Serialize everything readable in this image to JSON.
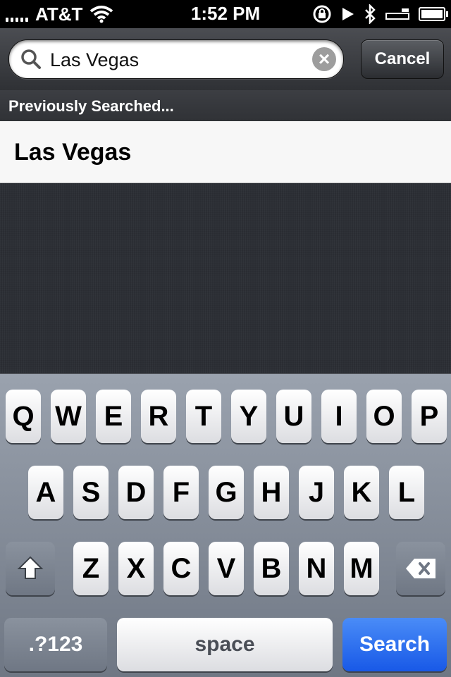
{
  "status_bar": {
    "carrier": "AT&T",
    "time": "1:52 PM"
  },
  "search": {
    "value": "Las Vegas",
    "cancel_label": "Cancel"
  },
  "section": {
    "header": "Previously Searched...",
    "items": [
      "Las Vegas"
    ]
  },
  "keyboard": {
    "row1": [
      "Q",
      "W",
      "E",
      "R",
      "T",
      "Y",
      "U",
      "I",
      "O",
      "P"
    ],
    "row2": [
      "A",
      "S",
      "D",
      "F",
      "G",
      "H",
      "J",
      "K",
      "L"
    ],
    "row3": [
      "Z",
      "X",
      "C",
      "V",
      "B",
      "N",
      "M"
    ],
    "numbers_label": ".?123",
    "space_label": "space",
    "search_label": "Search"
  },
  "colors": {
    "search_key": "#1859e7",
    "linen": "#2c2f35"
  }
}
